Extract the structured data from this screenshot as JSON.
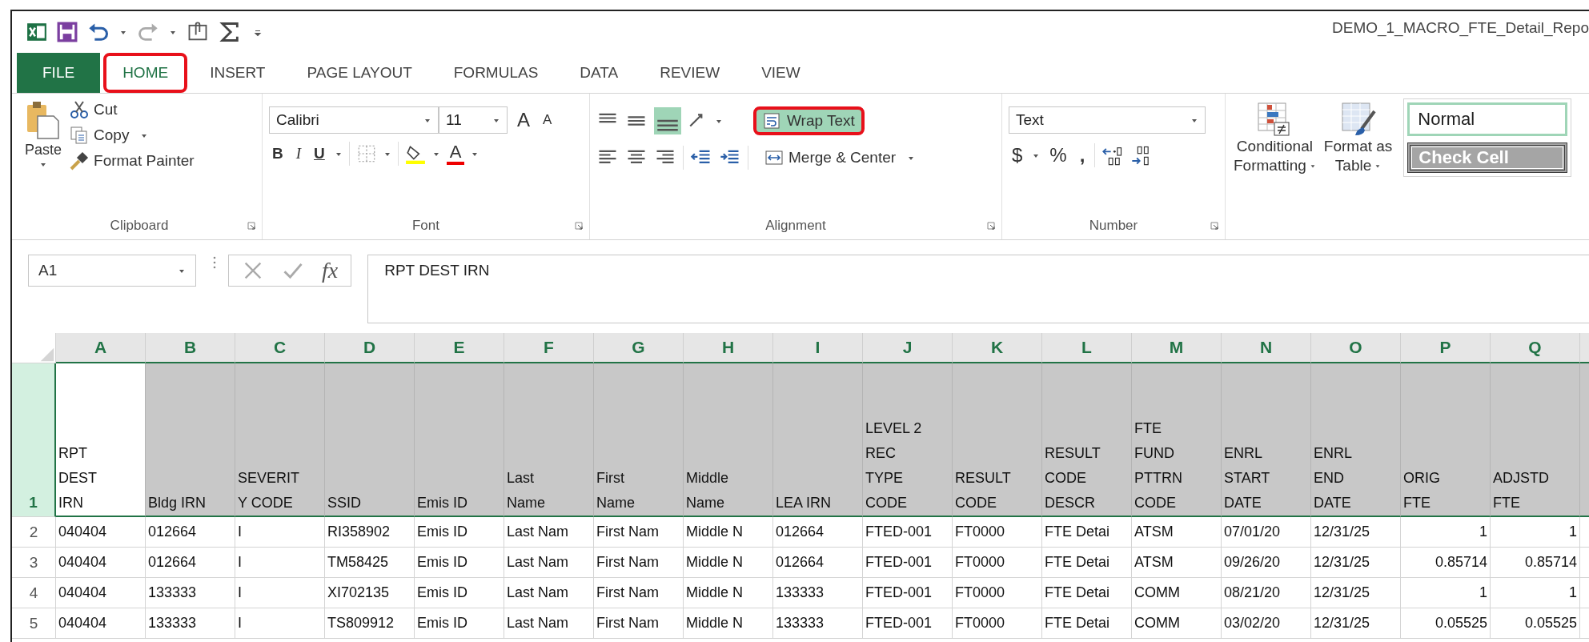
{
  "title": "DEMO_1_MACRO_FTE_Detail_Repo",
  "tabs": [
    {
      "label": "FILE",
      "kind": "file",
      "selected": false,
      "highlighted": false
    },
    {
      "label": "HOME",
      "kind": "tab",
      "selected": true,
      "highlighted": true
    },
    {
      "label": "INSERT",
      "kind": "tab",
      "selected": false,
      "highlighted": false
    },
    {
      "label": "PAGE LAYOUT",
      "kind": "tab",
      "selected": false,
      "highlighted": false
    },
    {
      "label": "FORMULAS",
      "kind": "tab",
      "selected": false,
      "highlighted": false
    },
    {
      "label": "DATA",
      "kind": "tab",
      "selected": false,
      "highlighted": false
    },
    {
      "label": "REVIEW",
      "kind": "tab",
      "selected": false,
      "highlighted": false
    },
    {
      "label": "VIEW",
      "kind": "tab",
      "selected": false,
      "highlighted": false
    }
  ],
  "ribbon": {
    "clipboard": {
      "label": "Clipboard",
      "paste": "Paste",
      "cut": "Cut",
      "copy": "Copy",
      "format_painter": "Format Painter"
    },
    "font": {
      "label": "Font",
      "name": "Calibri",
      "size": "11",
      "grow": "A",
      "shrink": "A",
      "bold": "B",
      "italic": "I",
      "underline": "U",
      "color_letter": "A"
    },
    "alignment": {
      "label": "Alignment",
      "bottom_align_on": true,
      "wrap_text": {
        "label": "Wrap Text",
        "on": true,
        "highlighted": true
      },
      "merge": "Merge & Center"
    },
    "number": {
      "label": "Number",
      "format": "Text",
      "currency": "$",
      "percent": "%",
      "comma": ","
    },
    "styles": {
      "conditional": [
        "Conditional",
        "Formatting"
      ],
      "format_table": [
        "Format as",
        "Table"
      ],
      "cells": [
        {
          "label": "Normal",
          "kind": "normal"
        },
        {
          "label": "Check Cell",
          "kind": "check"
        }
      ]
    }
  },
  "formula_bar": {
    "name_box": "A1",
    "fx": "fx",
    "value": "RPT DEST IRN"
  },
  "sheet": {
    "columns": [
      {
        "letter": "A",
        "header": [
          "RPT",
          "DEST",
          "IRN"
        ],
        "kind": "text",
        "selected": true
      },
      {
        "letter": "B",
        "header": [
          "Bldg IRN"
        ],
        "kind": "text",
        "selected": false
      },
      {
        "letter": "C",
        "header": [
          "SEVERIT",
          "Y CODE"
        ],
        "kind": "text",
        "selected": false
      },
      {
        "letter": "D",
        "header": [
          "SSID"
        ],
        "kind": "text",
        "selected": false
      },
      {
        "letter": "E",
        "header": [
          "Emis ID"
        ],
        "kind": "text",
        "selected": false
      },
      {
        "letter": "F",
        "header": [
          "Last",
          "Name"
        ],
        "kind": "text",
        "selected": false
      },
      {
        "letter": "G",
        "header": [
          "First",
          "Name"
        ],
        "kind": "text",
        "selected": false
      },
      {
        "letter": "H",
        "header": [
          "Middle",
          "Name"
        ],
        "kind": "text",
        "selected": false
      },
      {
        "letter": "I",
        "header": [
          "LEA IRN"
        ],
        "kind": "text",
        "selected": false
      },
      {
        "letter": "J",
        "header": [
          "LEVEL 2",
          "REC",
          "TYPE",
          "CODE"
        ],
        "kind": "text",
        "selected": false
      },
      {
        "letter": "K",
        "header": [
          "RESULT",
          "CODE"
        ],
        "kind": "text",
        "selected": false
      },
      {
        "letter": "L",
        "header": [
          "RESULT",
          "CODE",
          "DESCR"
        ],
        "kind": "text",
        "selected": false
      },
      {
        "letter": "M",
        "header": [
          "FTE",
          "FUND",
          "PTTRN",
          "CODE"
        ],
        "kind": "text",
        "selected": false
      },
      {
        "letter": "N",
        "header": [
          "ENRL",
          "START",
          "DATE"
        ],
        "kind": "text",
        "selected": false
      },
      {
        "letter": "O",
        "header": [
          "ENRL",
          "END",
          "DATE"
        ],
        "kind": "text",
        "selected": false
      },
      {
        "letter": "P",
        "header": [
          "ORIG",
          "FTE"
        ],
        "kind": "number",
        "selected": false
      },
      {
        "letter": "Q",
        "header": [
          "ADJSTD",
          "FTE"
        ],
        "kind": "number",
        "selected": false
      }
    ],
    "header_row": "1",
    "rows": [
      {
        "num": "2",
        "cells": [
          "040404",
          "012664",
          "I",
          "RI358902",
          "Emis ID",
          "Last Nam",
          "First Nam",
          "Middle N",
          "012664",
          "FTED-001",
          "FT0000",
          "FTE Detai",
          "ATSM",
          "07/01/20",
          "12/31/25",
          "1",
          "1"
        ]
      },
      {
        "num": "3",
        "cells": [
          "040404",
          "012664",
          "I",
          "TM58425",
          "Emis ID",
          "Last Nam",
          "First Nam",
          "Middle N",
          "012664",
          "FTED-001",
          "FT0000",
          "FTE Detai",
          "ATSM",
          "09/26/20",
          "12/31/25",
          "0.85714",
          "0.85714"
        ]
      },
      {
        "num": "4",
        "cells": [
          "040404",
          "133333",
          "I",
          "XI702135",
          "Emis ID",
          "Last Nam",
          "First Nam",
          "Middle N",
          "133333",
          "FTED-001",
          "FT0000",
          "FTE Detai",
          "COMM",
          "08/21/20",
          "12/31/25",
          "1",
          "1"
        ]
      },
      {
        "num": "5",
        "cells": [
          "040404",
          "133333",
          "I",
          "TS809912",
          "Emis ID",
          "Last Nam",
          "First Nam",
          "Middle N",
          "133333",
          "FTED-001",
          "FT0000",
          "FTE Detai",
          "COMM",
          "03/02/20",
          "12/31/25",
          "0.05525",
          "0.05525"
        ]
      }
    ]
  }
}
